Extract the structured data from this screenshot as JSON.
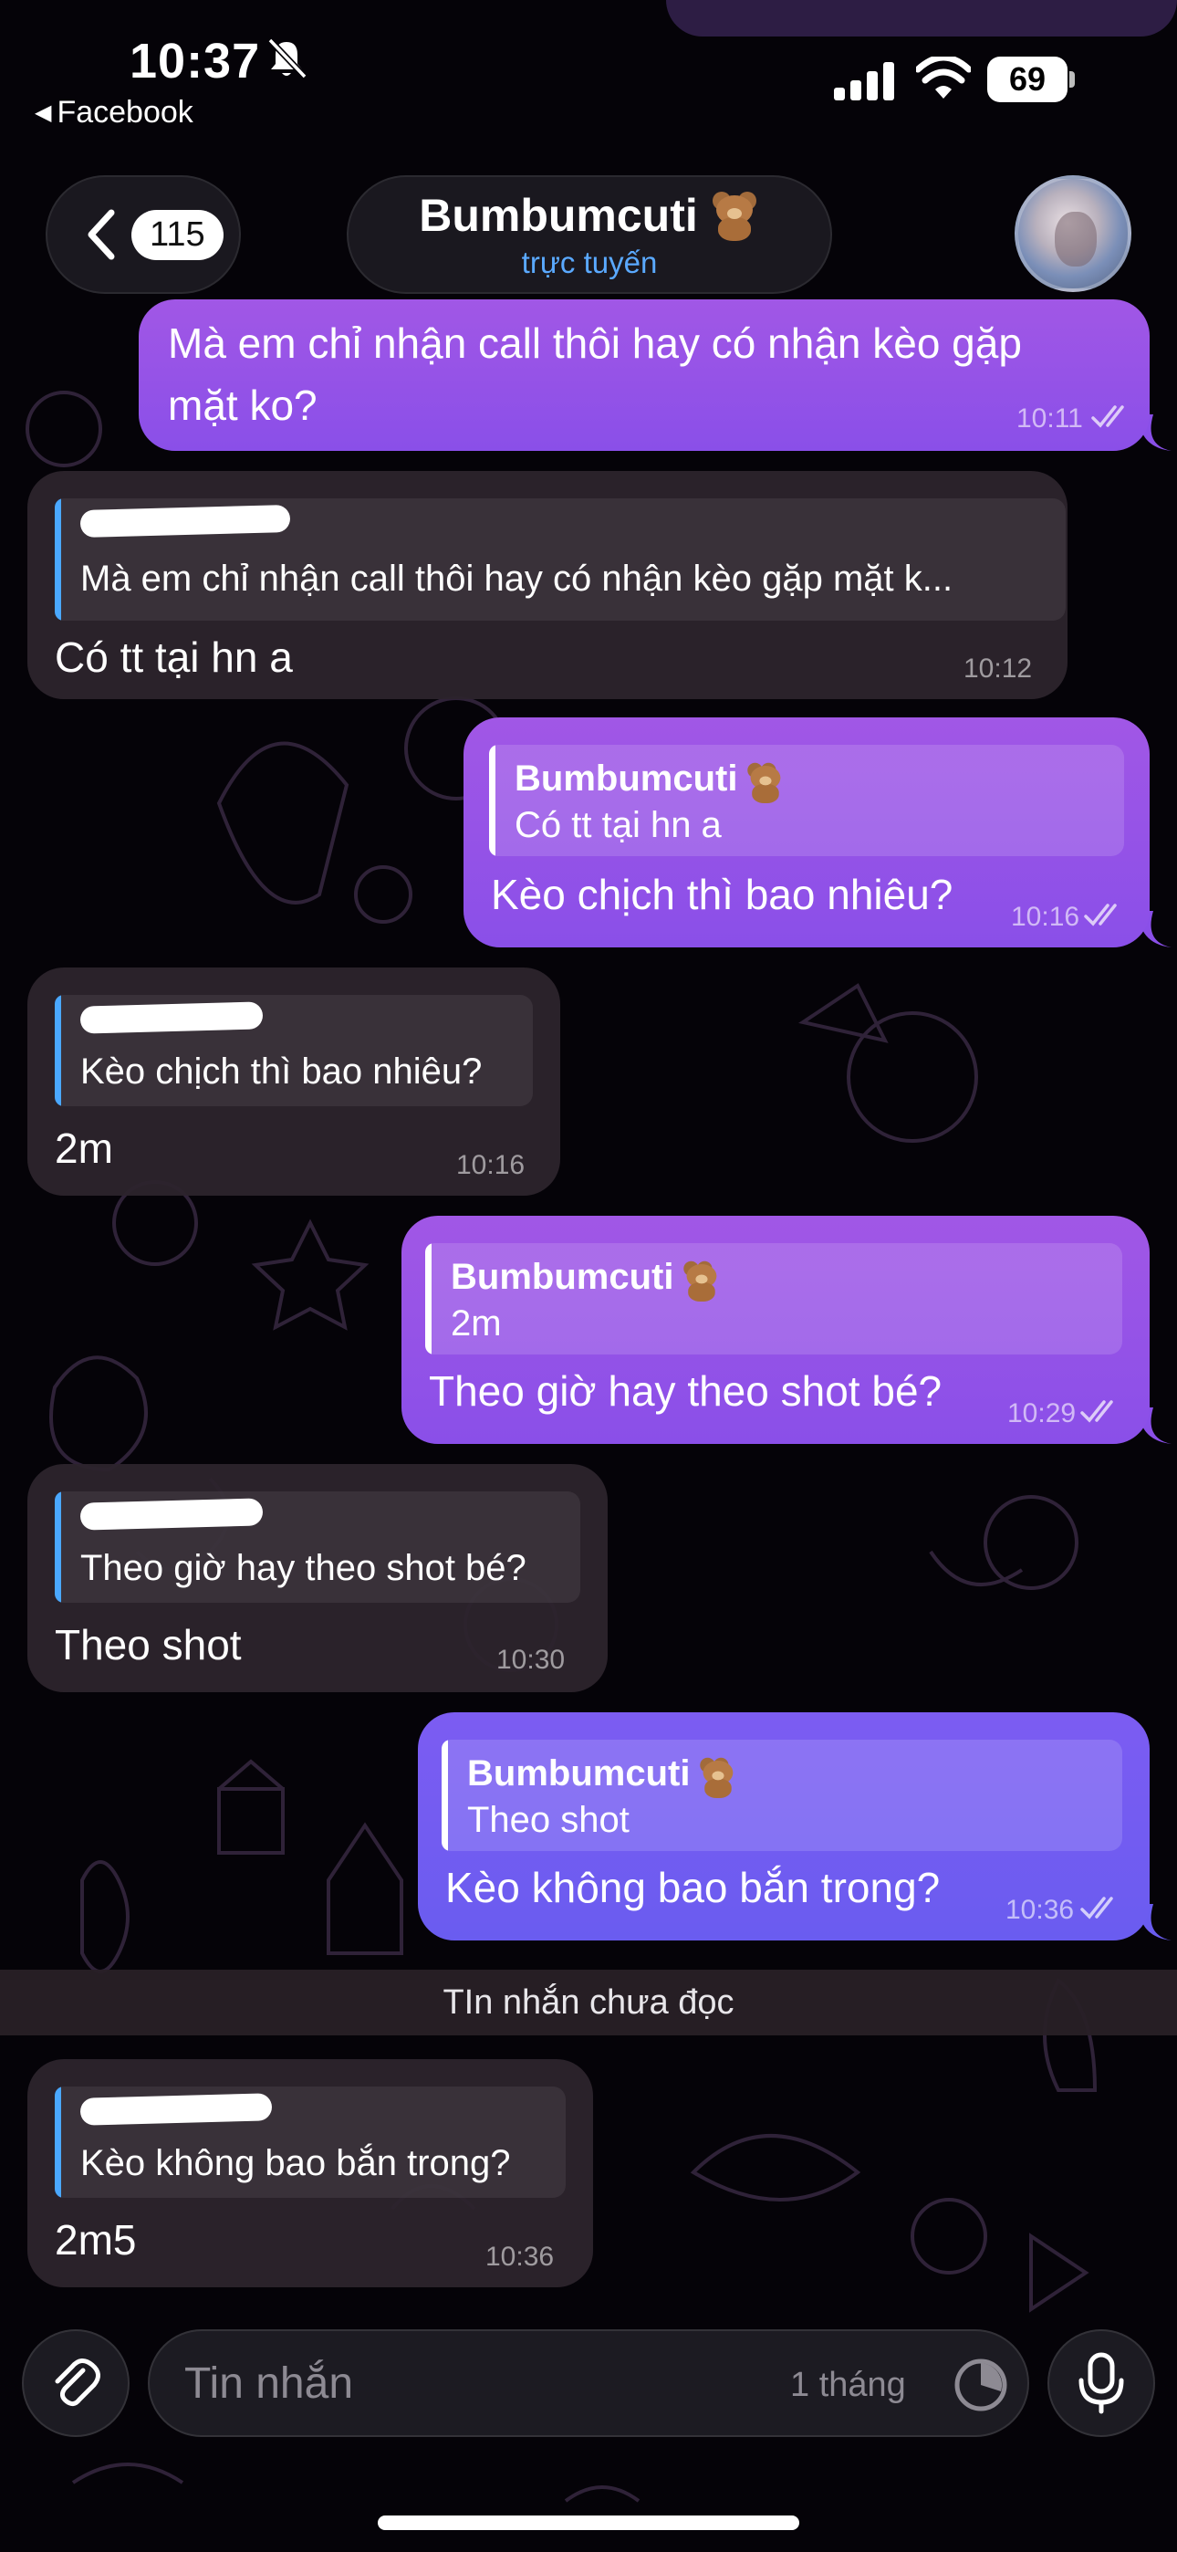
{
  "status_bar": {
    "time": "10:37",
    "back_app": "Facebook",
    "battery": "69",
    "icons": [
      "bell-slash-icon",
      "signal-icon",
      "wifi-icon",
      "battery-icon"
    ]
  },
  "header": {
    "back_count": "115",
    "title": "Bumbumcuti",
    "title_emoji": "teddy-bear-emoji",
    "status": "trực tuyến"
  },
  "messages": [
    {
      "dir": "out",
      "text_lines": [
        "Mà em chỉ nhận call thôi hay có nhận kèo gặp",
        "mặt ko?"
      ],
      "time": "10:11",
      "read": true
    },
    {
      "dir": "in",
      "quote_text": "Mà em chỉ nhận call thôi hay có nhận kèo gặp mặt k...",
      "text": "Có tt tại hn a",
      "time": "10:12"
    },
    {
      "dir": "out",
      "quote_name": "Bumbumcuti",
      "quote_text": "Có tt tại hn a",
      "text": "Kèo chịch thì bao nhiêu?",
      "time": "10:16",
      "read": true
    },
    {
      "dir": "in",
      "quote_text": "Kèo chịch thì bao nhiêu?",
      "text": "2m",
      "time": "10:16"
    },
    {
      "dir": "out",
      "quote_name": "Bumbumcuti",
      "quote_text": "2m",
      "text": "Theo giờ hay theo shot bé?",
      "time": "10:29",
      "read": true
    },
    {
      "dir": "in",
      "quote_text": "Theo giờ hay theo shot bé?",
      "text": "Theo shot",
      "time": "10:30"
    },
    {
      "dir": "out",
      "quote_name": "Bumbumcuti",
      "quote_text": "Theo shot",
      "text": "Kèo không bao bắn trong?",
      "time": "10:36",
      "read": true
    },
    {
      "dir": "in",
      "quote_text": "Kèo không bao bắn trong?",
      "text": "2m5",
      "time": "10:36"
    }
  ],
  "unread_divider": "TIn nhắn chưa đọc",
  "input": {
    "placeholder": "Tin nhắn",
    "timer_label": "1 tháng"
  },
  "colors": {
    "outgoing": "#9a55e8",
    "outgoing_last": "#7060f0",
    "incoming": "#2c242c",
    "accent": "#4aa8ff"
  }
}
